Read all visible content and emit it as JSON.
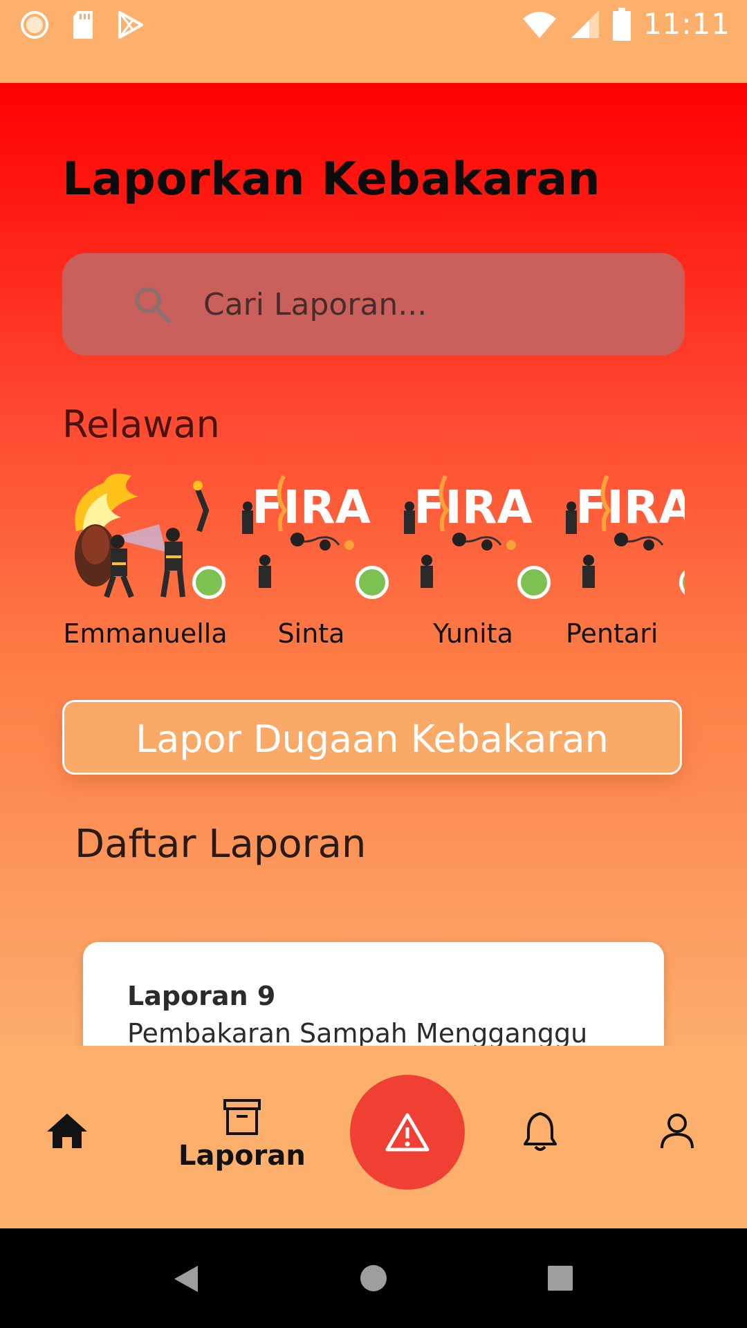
{
  "status_bar": {
    "time": "11:11",
    "icons": [
      "sync-icon",
      "sd-card-icon",
      "play-store-icon",
      "wifi-icon",
      "signal-icon",
      "battery-icon"
    ]
  },
  "header": {
    "title": "Laporkan Kebakaran"
  },
  "search": {
    "placeholder": "Cari Laporan..."
  },
  "volunteers": {
    "label": "Relawan",
    "items": [
      {
        "name": "Emmanuella",
        "online": true
      },
      {
        "name": "Sinta",
        "online": true
      },
      {
        "name": "Yunita",
        "online": true
      },
      {
        "name": "Pentari",
        "online": true
      }
    ],
    "logo_text": "FIRA"
  },
  "report_button": {
    "label": "Lapor Dugaan Kebakaran"
  },
  "report_list": {
    "title": "Daftar Laporan",
    "items": [
      {
        "title": "Laporan 9",
        "description": "Pembakaran Sampah Mengganggu"
      }
    ]
  },
  "bottom_nav": {
    "items": [
      {
        "icon": "home-icon",
        "label": ""
      },
      {
        "icon": "archive-box-icon",
        "label": "Laporan"
      },
      {
        "icon": "warning-triangle-icon",
        "label": ""
      },
      {
        "icon": "bell-icon",
        "label": ""
      },
      {
        "icon": "user-icon",
        "label": ""
      }
    ]
  },
  "colors": {
    "status_bar": "#FCB06C",
    "gradient_top": "#FF0000",
    "gradient_bottom": "#FCAD6C",
    "search_bg": "#C9605C",
    "online_dot": "#7DC152",
    "fab": "#F04034",
    "button_bg": "#FBA966"
  }
}
